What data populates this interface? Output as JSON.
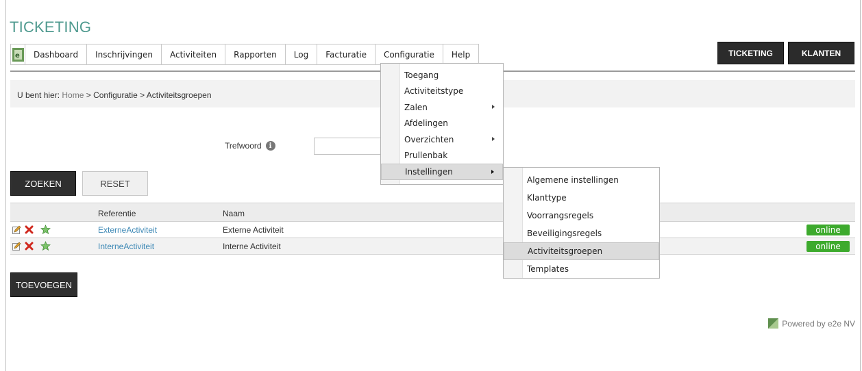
{
  "app": {
    "title": "TICKETING"
  },
  "nav": {
    "items": [
      {
        "label": "Dashboard"
      },
      {
        "label": "Inschrijvingen"
      },
      {
        "label": "Activiteiten"
      },
      {
        "label": "Rapporten"
      },
      {
        "label": "Log"
      },
      {
        "label": "Facturatie"
      },
      {
        "label": "Configuratie"
      },
      {
        "label": "Help"
      }
    ]
  },
  "topbuttons": {
    "ticketing": "TICKETING",
    "klanten": "KLANTEN"
  },
  "breadcrumb": {
    "prefix": "U bent hier:",
    "home": "Home",
    "rest": " > Configuratie > Activiteitsgroepen"
  },
  "search": {
    "label": "Trefwoord",
    "value": ""
  },
  "buttons": {
    "zoeken": "ZOEKEN",
    "reset": "RESET",
    "toevoegen": "TOEVOEGEN"
  },
  "table": {
    "headers": {
      "referentie": "Referentie",
      "naam": "Naam"
    },
    "rows": [
      {
        "referentie": "ExterneActiviteit",
        "naam": "Externe Activiteit",
        "status": "online"
      },
      {
        "referentie": "InterneActiviteit",
        "naam": "Interne Activiteit",
        "status": "online"
      }
    ]
  },
  "configMenu": {
    "items": [
      {
        "label": "Toegang"
      },
      {
        "label": "Activiteitstype"
      },
      {
        "label": "Zalen"
      },
      {
        "label": "Afdelingen"
      },
      {
        "label": "Overzichten"
      },
      {
        "label": "Prullenbak"
      },
      {
        "label": "Instellingen"
      }
    ]
  },
  "subMenu": {
    "items": [
      {
        "label": "Algemene instellingen"
      },
      {
        "label": "Klanttype"
      },
      {
        "label": "Voorrangsregels"
      },
      {
        "label": "Beveiligingsregels"
      },
      {
        "label": "Activiteitsgroepen"
      },
      {
        "label": "Templates"
      }
    ]
  },
  "footer": {
    "powered": "Powered by e2e NV"
  },
  "colors": {
    "accent": "#4f9a8f",
    "link": "#3d88b5",
    "online": "#3daa2d",
    "dark_button": "#2f2f2f"
  },
  "icons": [
    "e2e-logo-icon",
    "info-icon",
    "edit-icon",
    "delete-icon",
    "star-icon",
    "submenu-arrow-icon",
    "e2e-small-logo-icon"
  ]
}
